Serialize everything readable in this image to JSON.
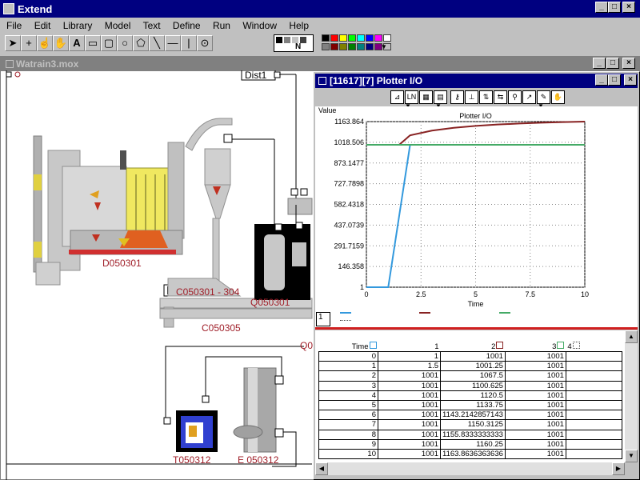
{
  "app": {
    "title": "Extend"
  },
  "menu": [
    "File",
    "Edit",
    "Library",
    "Model",
    "Text",
    "Define",
    "Run",
    "Window",
    "Help"
  ],
  "toolbar": {
    "pattern_label": "N"
  },
  "palette": {
    "colors": [
      "#000000",
      "#ff0000",
      "#ffff00",
      "#00ff00",
      "#00ffff",
      "#0000ff",
      "#ff00ff",
      "#ffffff",
      "#808080",
      "#800000",
      "#808000",
      "#008000",
      "#008080",
      "#000080",
      "#800080",
      "#c0c0c0"
    ]
  },
  "model_window": {
    "title": "Watrain3.mox"
  },
  "model_labels": {
    "dist": "Dist1",
    "d050301": "D050301",
    "c050301": "C050301 - 304",
    "q050301": "Q050301",
    "c050305": "C050305",
    "q0": "Q0",
    "t050312": "T050312",
    "e050312": "E 050312"
  },
  "plotter": {
    "title": "[11617][7]  Plotter I/O",
    "chart_title": "Plotter I/O",
    "page_tab": "1"
  },
  "chart_data": {
    "type": "line",
    "title": "Plotter I/O",
    "xlabel": "Time",
    "ylabel": "Value",
    "xlim": [
      0,
      10
    ],
    "ylim": [
      1,
      1163.864
    ],
    "x_ticks": [
      "0",
      "2.5",
      "5",
      "7.5",
      "10"
    ],
    "y_ticks": [
      "1163.864",
      "1018.506",
      "873.1477",
      "727.7898",
      "582.4318",
      "437.0739",
      "291.7159",
      "146.358",
      "1"
    ],
    "series": [
      {
        "color": "#3399dd",
        "x": [
          0,
          1,
          2,
          3,
          4,
          5,
          6,
          7,
          8,
          9,
          10
        ],
        "y": [
          1,
          1,
          1001,
          1001,
          1001,
          1001,
          1001,
          1001,
          1001,
          1001,
          1001
        ]
      },
      {
        "color": "#882222",
        "x": [
          0,
          1,
          1.5,
          2,
          3,
          4,
          5,
          6,
          7,
          8,
          9,
          10
        ],
        "y": [
          1001,
          1001,
          1001.25,
          1067.5,
          1100.625,
          1120.5,
          1133.75,
          1143.2142857143,
          1150.3125,
          1155.8333333333,
          1160.25,
          1163.8636363636
        ]
      },
      {
        "color": "#44aa66",
        "x": [
          0,
          1,
          2,
          3,
          4,
          5,
          6,
          7,
          8,
          9,
          10
        ],
        "y": [
          1001,
          1001,
          1001,
          1001,
          1001,
          1001,
          1001,
          1001,
          1001,
          1001,
          1001
        ]
      }
    ],
    "grid": true
  },
  "table": {
    "header": {
      "time": "Time",
      "c1": "1",
      "c2": "2",
      "c3": "3",
      "c4": "4"
    },
    "rows": [
      [
        "0",
        "1",
        "1001",
        "1001"
      ],
      [
        "1",
        "1.5",
        "1001.25",
        "1001"
      ],
      [
        "2",
        "1001",
        "1067.5",
        "1001"
      ],
      [
        "3",
        "1001",
        "1100.625",
        "1001"
      ],
      [
        "4",
        "1001",
        "1120.5",
        "1001"
      ],
      [
        "5",
        "1001",
        "1133.75",
        "1001"
      ],
      [
        "6",
        "1001",
        "1143.2142857143",
        "1001"
      ],
      [
        "7",
        "1001",
        "1150.3125",
        "1001"
      ],
      [
        "8",
        "1001",
        "1155.8333333333",
        "1001"
      ],
      [
        "9",
        "1001",
        "1160.25",
        "1001"
      ],
      [
        "10",
        "1001",
        "1163.8636363636",
        "1001"
      ]
    ]
  }
}
